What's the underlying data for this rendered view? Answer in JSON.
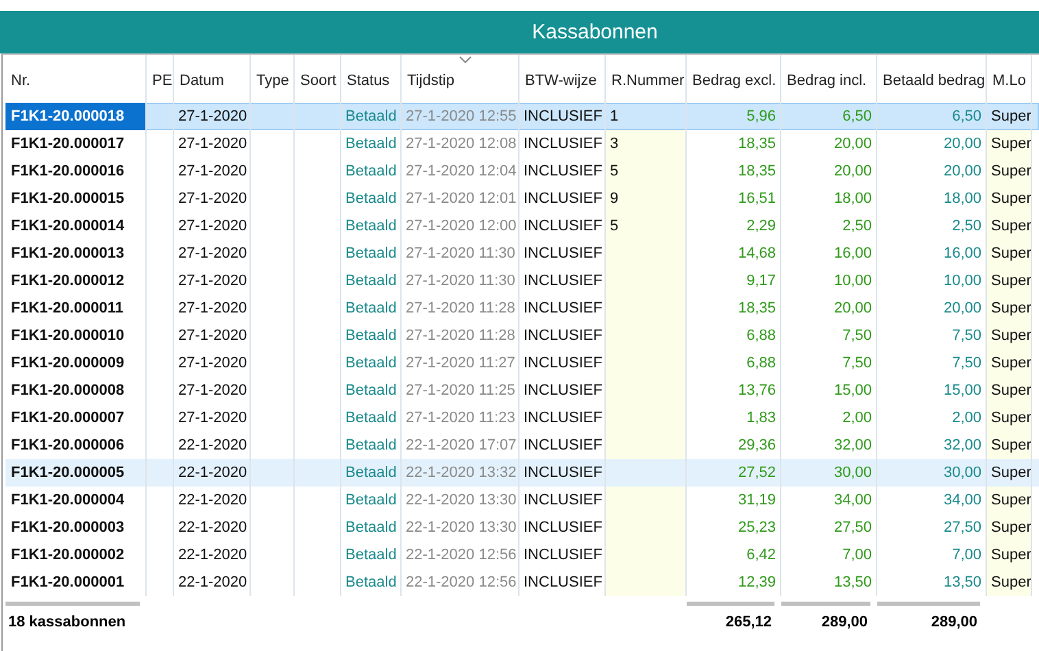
{
  "window": {
    "title": "Kassabonnen"
  },
  "table": {
    "columns": [
      {
        "label": "Nr.",
        "kind": "nr"
      },
      {
        "label": "PE",
        "kind": "pe"
      },
      {
        "label": "Datum",
        "kind": "datum"
      },
      {
        "label": "Type",
        "kind": "type"
      },
      {
        "label": "Soort",
        "kind": "soort"
      },
      {
        "label": "Status",
        "kind": "status"
      },
      {
        "label": "Tijdstip",
        "kind": "tijdstip",
        "sorted": true
      },
      {
        "label": "BTW-wijze",
        "kind": "btw"
      },
      {
        "label": "R.Nummer",
        "kind": "rnr"
      },
      {
        "label": "Bedrag excl.",
        "kind": "excl"
      },
      {
        "label": "Bedrag incl.",
        "kind": "incl"
      },
      {
        "label": "Betaald bedrag",
        "kind": "betaald"
      },
      {
        "label": "M.Lo",
        "kind": "mlog"
      }
    ],
    "rows": [
      {
        "nr": "F1K1-20.000018",
        "datum": "27-1-2020",
        "status": "Betaald",
        "tijdstip": "27-1-2020 12:55",
        "btw": "INCLUSIEF",
        "rnr": "1",
        "excl": "5,96",
        "incl": "6,50",
        "betaald": "6,50",
        "mlog": "Super",
        "selected": true,
        "highlighted": false
      },
      {
        "nr": "F1K1-20.000017",
        "datum": "27-1-2020",
        "status": "Betaald",
        "tijdstip": "27-1-2020 12:08",
        "btw": "INCLUSIEF",
        "rnr": "3",
        "excl": "18,35",
        "incl": "20,00",
        "betaald": "20,00",
        "mlog": "Super",
        "selected": false,
        "highlighted": false
      },
      {
        "nr": "F1K1-20.000016",
        "datum": "27-1-2020",
        "status": "Betaald",
        "tijdstip": "27-1-2020 12:04",
        "btw": "INCLUSIEF",
        "rnr": "5",
        "excl": "18,35",
        "incl": "20,00",
        "betaald": "20,00",
        "mlog": "Super",
        "selected": false,
        "highlighted": false
      },
      {
        "nr": "F1K1-20.000015",
        "datum": "27-1-2020",
        "status": "Betaald",
        "tijdstip": "27-1-2020 12:01",
        "btw": "INCLUSIEF",
        "rnr": "9",
        "excl": "16,51",
        "incl": "18,00",
        "betaald": "18,00",
        "mlog": "Super",
        "selected": false,
        "highlighted": false
      },
      {
        "nr": "F1K1-20.000014",
        "datum": "27-1-2020",
        "status": "Betaald",
        "tijdstip": "27-1-2020 12:00",
        "btw": "INCLUSIEF",
        "rnr": "5",
        "excl": "2,29",
        "incl": "2,50",
        "betaald": "2,50",
        "mlog": "Super",
        "selected": false,
        "highlighted": false
      },
      {
        "nr": "F1K1-20.000013",
        "datum": "27-1-2020",
        "status": "Betaald",
        "tijdstip": "27-1-2020 11:30",
        "btw": "INCLUSIEF",
        "excl": "14,68",
        "incl": "16,00",
        "betaald": "16,00",
        "mlog": "Super",
        "selected": false,
        "highlighted": false
      },
      {
        "nr": "F1K1-20.000012",
        "datum": "27-1-2020",
        "status": "Betaald",
        "tijdstip": "27-1-2020 11:30",
        "btw": "INCLUSIEF",
        "excl": "9,17",
        "incl": "10,00",
        "betaald": "10,00",
        "mlog": "Super",
        "selected": false,
        "highlighted": false
      },
      {
        "nr": "F1K1-20.000011",
        "datum": "27-1-2020",
        "status": "Betaald",
        "tijdstip": "27-1-2020 11:28",
        "btw": "INCLUSIEF",
        "excl": "18,35",
        "incl": "20,00",
        "betaald": "20,00",
        "mlog": "Super",
        "selected": false,
        "highlighted": false
      },
      {
        "nr": "F1K1-20.000010",
        "datum": "27-1-2020",
        "status": "Betaald",
        "tijdstip": "27-1-2020 11:28",
        "btw": "INCLUSIEF",
        "excl": "6,88",
        "incl": "7,50",
        "betaald": "7,50",
        "mlog": "Super",
        "selected": false,
        "highlighted": false
      },
      {
        "nr": "F1K1-20.000009",
        "datum": "27-1-2020",
        "status": "Betaald",
        "tijdstip": "27-1-2020 11:27",
        "btw": "INCLUSIEF",
        "excl": "6,88",
        "incl": "7,50",
        "betaald": "7,50",
        "mlog": "Super",
        "selected": false,
        "highlighted": false
      },
      {
        "nr": "F1K1-20.000008",
        "datum": "27-1-2020",
        "status": "Betaald",
        "tijdstip": "27-1-2020 11:25",
        "btw": "INCLUSIEF",
        "excl": "13,76",
        "incl": "15,00",
        "betaald": "15,00",
        "mlog": "Super",
        "selected": false,
        "highlighted": false
      },
      {
        "nr": "F1K1-20.000007",
        "datum": "27-1-2020",
        "status": "Betaald",
        "tijdstip": "27-1-2020 11:23",
        "btw": "INCLUSIEF",
        "excl": "1,83",
        "incl": "2,00",
        "betaald": "2,00",
        "mlog": "Super",
        "selected": false,
        "highlighted": false
      },
      {
        "nr": "F1K1-20.000006",
        "datum": "22-1-2020",
        "status": "Betaald",
        "tijdstip": "22-1-2020 17:07",
        "btw": "INCLUSIEF",
        "excl": "29,36",
        "incl": "32,00",
        "betaald": "32,00",
        "mlog": "Super",
        "selected": false,
        "highlighted": false
      },
      {
        "nr": "F1K1-20.000005",
        "datum": "22-1-2020",
        "status": "Betaald",
        "tijdstip": "22-1-2020 13:32",
        "btw": "INCLUSIEF",
        "excl": "27,52",
        "incl": "30,00",
        "betaald": "30,00",
        "mlog": "Super",
        "selected": false,
        "highlighted": true
      },
      {
        "nr": "F1K1-20.000004",
        "datum": "22-1-2020",
        "status": "Betaald",
        "tijdstip": "22-1-2020 13:30",
        "btw": "INCLUSIEF",
        "excl": "31,19",
        "incl": "34,00",
        "betaald": "34,00",
        "mlog": "Super",
        "selected": false,
        "highlighted": false
      },
      {
        "nr": "F1K1-20.000003",
        "datum": "22-1-2020",
        "status": "Betaald",
        "tijdstip": "22-1-2020 13:30",
        "btw": "INCLUSIEF",
        "excl": "25,23",
        "incl": "27,50",
        "betaald": "27,50",
        "mlog": "Super",
        "selected": false,
        "highlighted": false
      },
      {
        "nr": "F1K1-20.000002",
        "datum": "22-1-2020",
        "status": "Betaald",
        "tijdstip": "22-1-2020 12:56",
        "btw": "INCLUSIEF",
        "excl": "6,42",
        "incl": "7,00",
        "betaald": "7,00",
        "mlog": "Super",
        "selected": false,
        "highlighted": false
      },
      {
        "nr": "F1K1-20.000001",
        "datum": "22-1-2020",
        "status": "Betaald",
        "tijdstip": "22-1-2020 12:56",
        "btw": "INCLUSIEF",
        "excl": "12,39",
        "incl": "13,50",
        "betaald": "13,50",
        "mlog": "Super",
        "selected": false,
        "highlighted": false
      }
    ],
    "footer": {
      "count": "18 kassabonnen",
      "excl": "265,12",
      "incl": "289,00",
      "betaald": "289,00"
    }
  }
}
